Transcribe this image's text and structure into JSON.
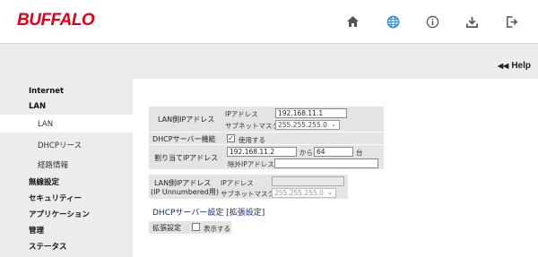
{
  "header": {
    "logo": "BUFFALO",
    "icons": [
      "home-icon",
      "globe-icon",
      "info-icon",
      "download-icon",
      "logout-icon"
    ],
    "accent": "#e0001b",
    "globe_color": "#2e8bd6"
  },
  "help": {
    "label": "Help",
    "arrow": "◀◀"
  },
  "sidebar": {
    "items": [
      {
        "label": "Internet"
      },
      {
        "label": "LAN"
      },
      {
        "label": "LAN"
      },
      {
        "label": "DHCPリース"
      },
      {
        "label": "経路情報"
      },
      {
        "label": "無線設定"
      },
      {
        "label": "セキュリティー"
      },
      {
        "label": "アプリケーション"
      },
      {
        "label": "管理"
      },
      {
        "label": "ステータス"
      }
    ]
  },
  "lan_ip": {
    "label": "LAN側IPアドレス",
    "ip_label": "IPアドレス",
    "ip_value": "192.168.11.1",
    "mask_label": "サブネットマスク",
    "mask_value": "255.255.255.0"
  },
  "dhcp": {
    "label": "DHCPサーバー機能",
    "use_label": "使用する",
    "use_checked": true
  },
  "assign": {
    "label": "割り当てIPアドレス",
    "start_value": "192.168.11.2",
    "from_label": "から",
    "count_value": "64",
    "unit_label": "台",
    "exclude_label": "除外IPアドレス:",
    "exclude_value": ""
  },
  "unnumbered": {
    "label_line1": "LAN側IPアドレス",
    "label_line2": "(IP Unnumbered用)",
    "ip_label": "IPアドレス",
    "ip_value": "",
    "mask_label": "サブネットマスク",
    "mask_value": "255.255.255.0"
  },
  "advanced": {
    "title": "DHCPサーバー設定 [拡張設定]",
    "label": "拡張設定",
    "show_label": "表示する",
    "show_checked": false
  }
}
